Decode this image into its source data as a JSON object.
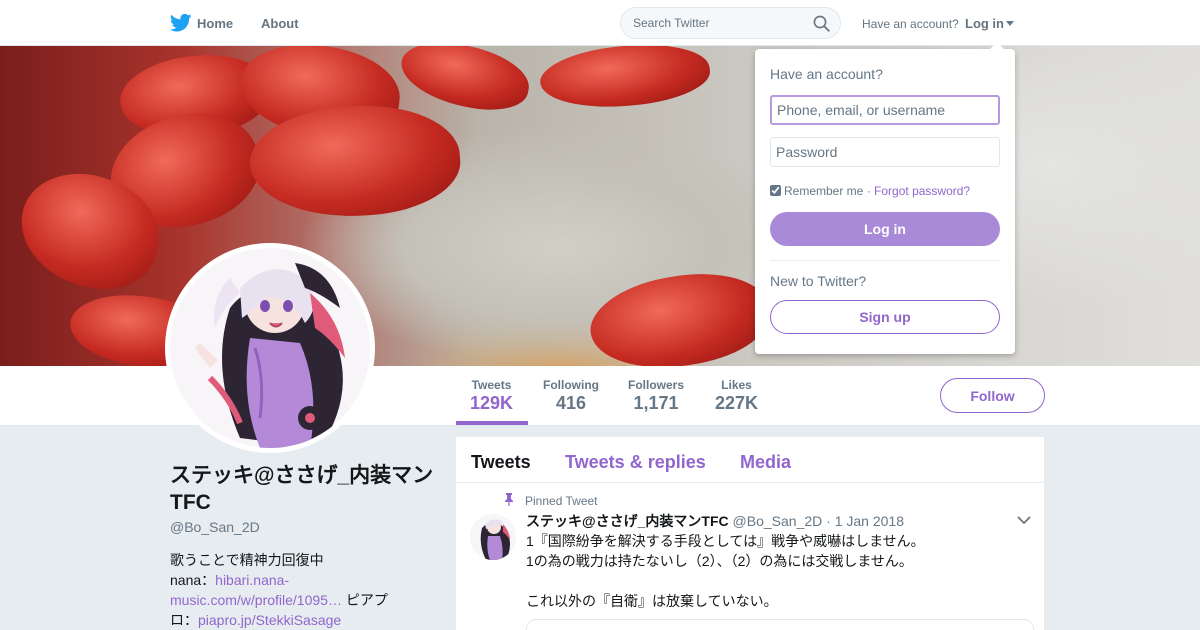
{
  "colors": {
    "accent": "#9266cc",
    "twitter_blue": "#1da1f2",
    "background": "#e6ecf0"
  },
  "nav": {
    "logo_icon": "twitter-bird-icon",
    "home": "Home",
    "about": "About",
    "search_placeholder": "Search Twitter",
    "have_account": "Have an account?",
    "login": "Log in"
  },
  "login_dropdown": {
    "heading": "Have an account?",
    "username_placeholder": "Phone, email, or username",
    "password_placeholder": "Password",
    "remember_me": "Remember me",
    "separator": "·",
    "forgot_password": "Forgot password?",
    "login_button": "Log in",
    "new_to_twitter": "New to Twitter?",
    "signup_button": "Sign up"
  },
  "stats": [
    {
      "label": "Tweets",
      "value": "129K",
      "active": true
    },
    {
      "label": "Following",
      "value": "416"
    },
    {
      "label": "Followers",
      "value": "1,171"
    },
    {
      "label": "Likes",
      "value": "227K"
    }
  ],
  "follow_button": "Follow",
  "profile": {
    "name": "ステッキ@ささげ_内装マンTFC",
    "handle": "@Bo_San_2D",
    "bio_line1": "歌うことで精神力回復中",
    "bio_nana_prefix": "nana：",
    "bio_nana_link": "hibari.nana-music.com/w/profile/1095…",
    "bio_piapro_prefix": " ピアプロ：",
    "bio_piapro_link": "piapro.jp/StekkiSasage"
  },
  "timeline": {
    "tabs": [
      "Tweets",
      "Tweets & replies",
      "Media"
    ],
    "pinned_label": "Pinned Tweet",
    "tweet": {
      "name": "ステッキ@ささげ_内装マンTFC",
      "handle": "@Bo_San_2D",
      "separator": "·",
      "date": "1 Jan 2018",
      "line1": "1『国際紛争を解決する手段としては』戦争や威嚇はしません。",
      "line2": "1の為の戦力は持たないし（2）、（2）の為には交戦しません。",
      "line3": "これ以外の『自衛』は放棄していない。"
    }
  }
}
